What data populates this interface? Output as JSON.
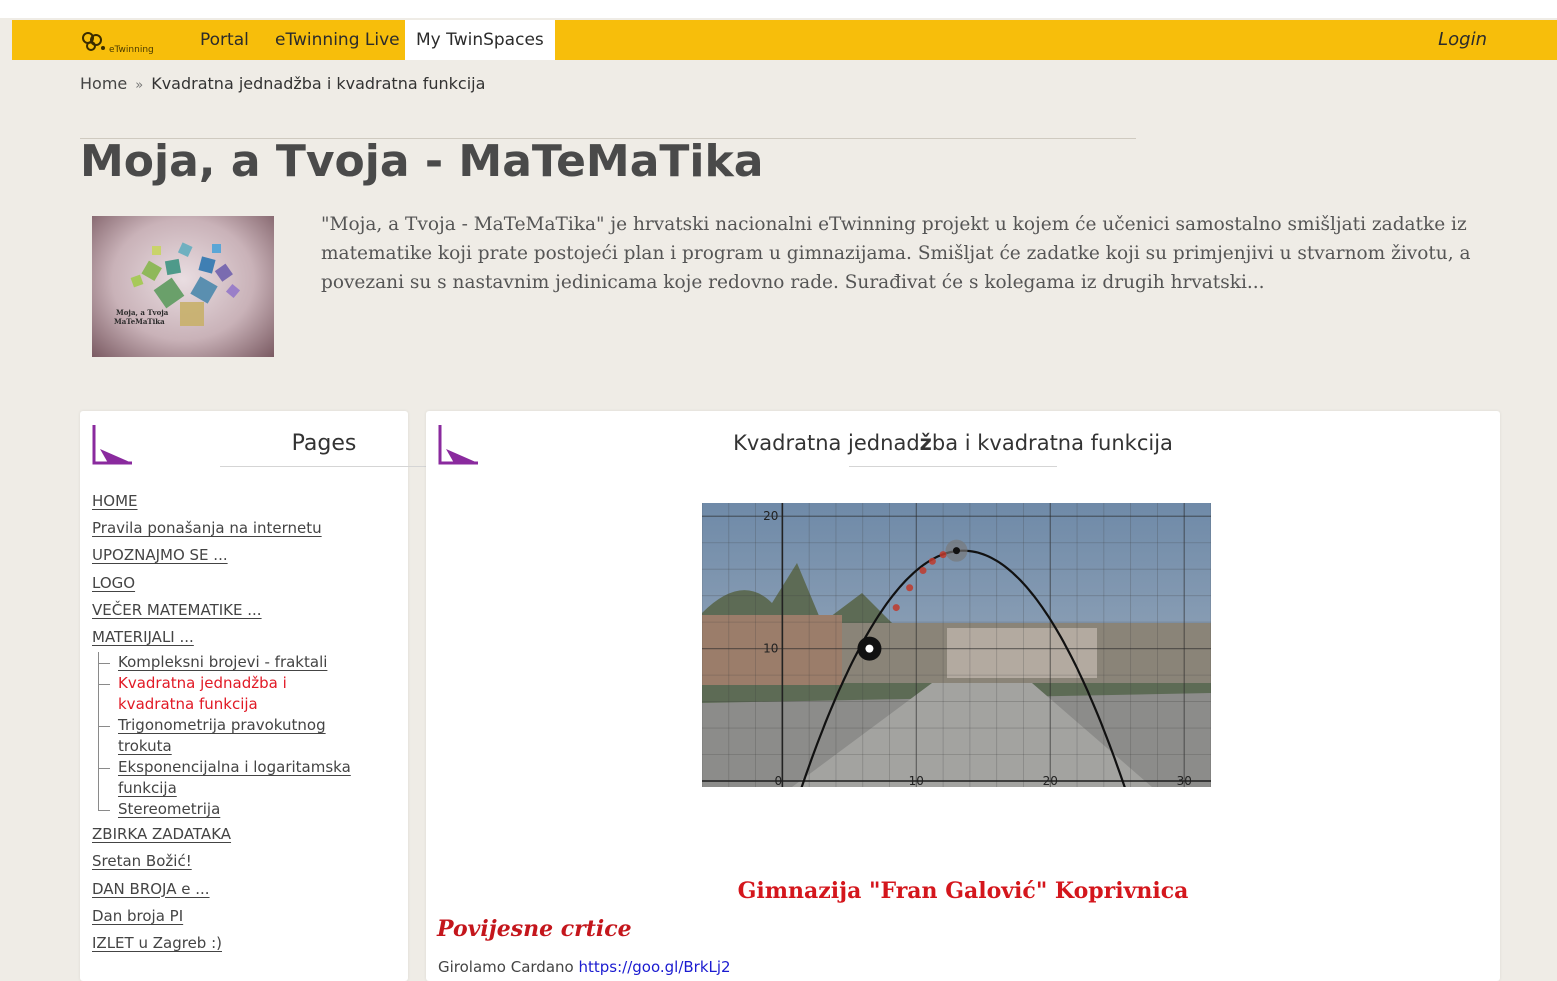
{
  "nav": {
    "logo_text": "eTwinning",
    "items": [
      {
        "label": "Portal"
      },
      {
        "label": "eTwinning Live"
      },
      {
        "label": "My TwinSpaces"
      }
    ],
    "login": "Login"
  },
  "breadcrumb": {
    "home": "Home",
    "separator": "»",
    "current": "Kvadratna jednadžba i kvadratna funkcija"
  },
  "project": {
    "title": "Moja, a Tvoja - MaTeMaTika",
    "image_caption_1": "Moja, a Tvoja",
    "image_caption_2": "MaTeMaTika",
    "description": "\"Moja, a Tvoja - MaTeMaTika\" je hrvatski nacionalni eTwinning projekt u kojem će učenici samostalno smišljati zadatke iz matematike koji prate postojeći plan i program u gimnazijama. Smišljat će zadatke koji su primjenjivi u stvarnom životu, a povezani su s nastavnim jedinicama koje redovno rade. Surađivat će s kolegama iz drugih hrvatski..."
  },
  "pages": {
    "title": "Pages",
    "items_top": [
      "HOME",
      "Pravila ponašanja na internetu",
      "UPOZNAJMO SE ...",
      "LOGO",
      "VEČER MATEMATIKE ...",
      "MATERIJALI ..."
    ],
    "subitems": [
      {
        "label": "Kompleksni brojevi - fraktali"
      },
      {
        "label": "Kvadratna jednadžba i kvadratna funkcija"
      },
      {
        "label": "Trigonometrija pravokutnog trokuta"
      },
      {
        "label": "Eksponencijalna i logaritamska funkcija"
      },
      {
        "label": "Stereometrija"
      }
    ],
    "items_bottom": [
      "ZBIRKA ZADATAKA",
      "Sretan Božić!",
      "DAN BROJA e ...",
      "Dan broja PI",
      "IZLET u Zagreb :)"
    ]
  },
  "main": {
    "title_pre": "Kvadratna jednad",
    "title_bold": "ž",
    "title_post": "ba i kvadratna funkcija",
    "school": "Gimnazija \"Fran Galović\" Koprivnica",
    "section": "Povijesne crtice",
    "last_text": "Girolamo Cardano",
    "last_link": "https://goo.gl/BrkLj2"
  },
  "chart_data": {
    "type": "scatter",
    "title": "",
    "xlabel": "",
    "ylabel": "",
    "x_ticks": [
      "0",
      "10",
      "20",
      "30"
    ],
    "y_ticks": [
      "10",
      "20"
    ],
    "xlim": [
      -6,
      32
    ],
    "ylim": [
      0,
      21
    ],
    "grid": true,
    "series": [
      {
        "kind": "parabola",
        "vertex": [
          13.5,
          17.4
        ],
        "roots": [
          1.6,
          25.4
        ]
      },
      {
        "kind": "points",
        "points": [
          [
            8.5,
            13.1
          ],
          [
            9.5,
            14.6
          ],
          [
            10.5,
            15.9
          ],
          [
            11.2,
            16.6
          ],
          [
            12.0,
            17.1
          ],
          [
            13.0,
            17.4
          ],
          [
            6.5,
            10.0
          ]
        ]
      }
    ]
  },
  "colors": {
    "navbar": "#f7be0b",
    "accent_purple": "#8a2a9e",
    "link_red": "#e11a26",
    "heading_red": "#c4161c"
  }
}
